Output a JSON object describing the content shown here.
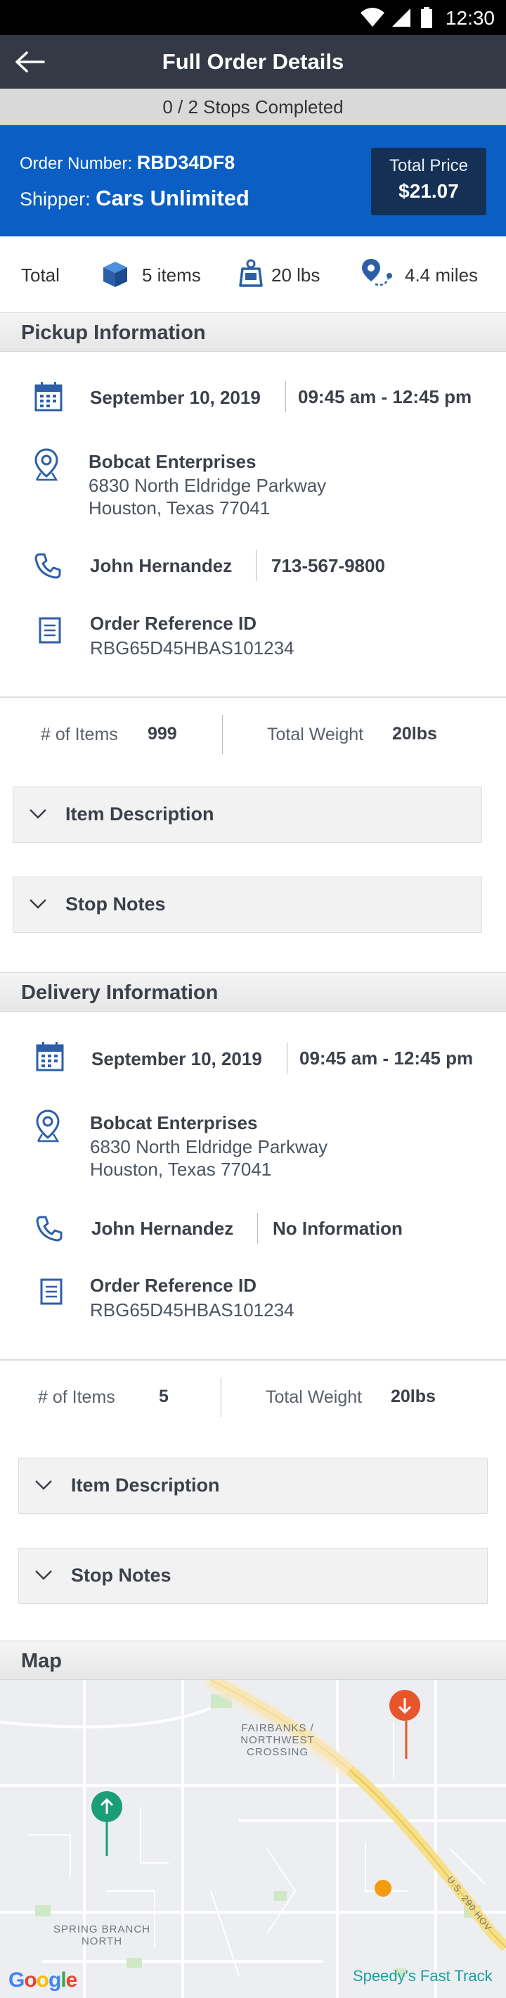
{
  "status": {
    "time": "12:30"
  },
  "header": {
    "title": "Full Order Details"
  },
  "progress": {
    "text": "0 / 2 Stops Completed"
  },
  "order": {
    "number_label": "Order Number:",
    "number": "RBD34DF8",
    "shipper_label": "Shipper:",
    "shipper": "Cars Unlimited",
    "price_label": "Total Price",
    "price": "$21.07"
  },
  "summary": {
    "total_label": "Total",
    "items": "5 items",
    "weight": "20 lbs",
    "distance": "4.4 miles"
  },
  "pickup": {
    "title": "Pickup Information",
    "date": "September 10, 2019",
    "time": "09:45 am - 12:45 pm",
    "company": "Bobcat Enterprises",
    "address1": "6830 North Eldridge Parkway",
    "address2": "Houston, Texas 77041",
    "contact": "John Hernandez",
    "phone": "713-567-9800",
    "ref_label": "Order Reference ID",
    "ref_id": "RBG65D45HBAS101234",
    "items_label": "# of Items",
    "items_value": "999",
    "weight_label": "Total Weight",
    "weight_value": "20lbs",
    "item_desc": "Item Description",
    "stop_notes": "Stop Notes"
  },
  "delivery": {
    "title": "Delivery Information",
    "date": "September 10, 2019",
    "time": "09:45 am - 12:45 pm",
    "company": "Bobcat Enterprises",
    "address1": "6830 North Eldridge Parkway",
    "address2": "Houston, Texas 77041",
    "contact": "John Hernandez",
    "phone": "No Information",
    "ref_label": "Order Reference ID",
    "ref_id": "RBG65D45HBAS101234",
    "items_label": "# of Items",
    "items_value": "5",
    "weight_label": "Total Weight",
    "weight_value": "20lbs",
    "item_desc": "Item Description",
    "stop_notes": "Stop Notes"
  },
  "map": {
    "title": "Map",
    "label_crossing": "FAIRBANKS / NORTHWEST CROSSING",
    "label_spring": "SPRING BRANCH NORTH",
    "label_road": "U.S. 290 HOV",
    "google": "Google",
    "place": "Speedy's Fast Track"
  },
  "colors": {
    "appbar": "#343a45",
    "order_band": "#0b5fc4",
    "price_box": "#153055",
    "icon_blue": "#2d5fa8",
    "pin_origin": "#1a9e77",
    "pin_destination": "#e8552a",
    "pin_waypoint": "#f39c12"
  }
}
